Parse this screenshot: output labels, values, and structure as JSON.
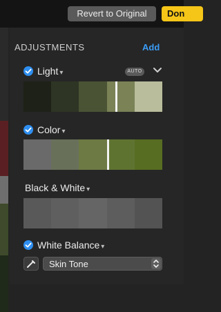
{
  "toolbar": {
    "revert_label": "Revert to Original",
    "done_label": "Don"
  },
  "panel": {
    "header": "ADJUSTMENTS",
    "add_label": "Add",
    "light": {
      "label": "Light",
      "auto_badge": "AUTO"
    },
    "color": {
      "label": "Color"
    },
    "black_white": {
      "label": "Black & White"
    },
    "white_balance": {
      "label": "White Balance",
      "selected_option": "Skin Tone"
    }
  },
  "colors": {
    "accent_blue": "#2f8ff0",
    "add_link": "#3b9cf5",
    "done_yellow": "#f5c518"
  },
  "icons": {
    "check": "checkmark-circle-icon",
    "caret": "chevron-down-icon",
    "picker": "eyedropper-icon",
    "updown": "up-down-arrows-icon"
  }
}
